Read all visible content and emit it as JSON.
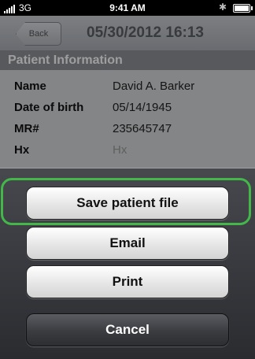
{
  "status_bar": {
    "carrier": "3G",
    "time": "9:41 AM"
  },
  "nav": {
    "back_label": "Back",
    "title": "05/30/2012 16:13"
  },
  "section": {
    "title": "Patient Information"
  },
  "patient": {
    "rows": [
      {
        "label": "Name",
        "value": "David A. Barker"
      },
      {
        "label": "Date of birth",
        "value": "05/14/1945"
      },
      {
        "label": "MR#",
        "value": "235645747"
      },
      {
        "label": "Hx",
        "value": "Hx"
      }
    ]
  },
  "action_sheet": {
    "save_label": "Save patient file",
    "email_label": "Email",
    "print_label": "Print",
    "cancel_label": "Cancel"
  },
  "colors": {
    "highlight": "#43b749"
  }
}
